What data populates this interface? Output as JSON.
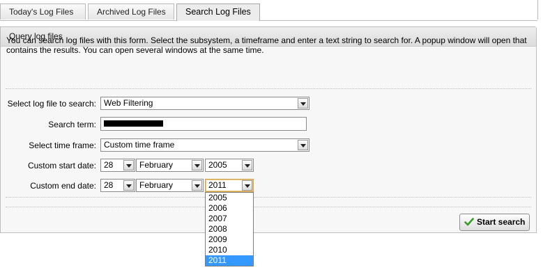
{
  "tabs": [
    {
      "label": "Today's Log Files",
      "active": false
    },
    {
      "label": "Archived Log Files",
      "active": false
    },
    {
      "label": "Search Log Files",
      "active": true
    }
  ],
  "panel": {
    "title": "Query log files",
    "intro": "You can search log files with this form. Select the subsystem, a timeframe and enter a text string to search for. A popup window will open that contains the results. You can open several windows at the same time."
  },
  "form": {
    "log_file_label": "Select log file to search:",
    "log_file_value": "Web Filtering",
    "search_term_label": "Search term:",
    "timeframe_label": "Select time frame:",
    "timeframe_value": "Custom time frame",
    "start_label": "Custom start date:",
    "start_day": "28",
    "start_month": "February",
    "start_year": "2005",
    "end_label": "Custom end date:",
    "end_day": "28",
    "end_month": "February",
    "end_year": "2011"
  },
  "year_options": [
    "2005",
    "2006",
    "2007",
    "2008",
    "2009",
    "2010",
    "2011"
  ],
  "selected_year": "2011",
  "buttons": {
    "start_search": "Start search"
  },
  "colors": {
    "selection": "#3399ff",
    "button_check": "#3a9a2a"
  }
}
